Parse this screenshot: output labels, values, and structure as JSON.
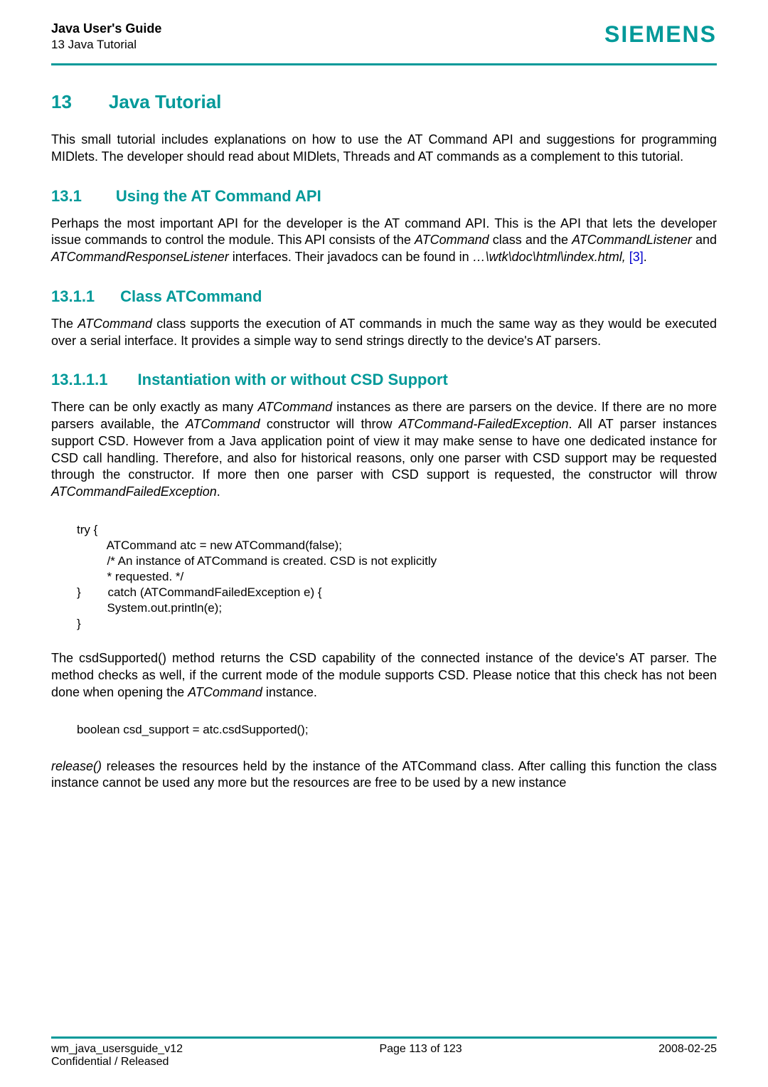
{
  "header": {
    "guide_title": "Java User's Guide",
    "section_ref": "13 Java Tutorial",
    "brand": "SIEMENS"
  },
  "chapter": {
    "num": "13",
    "title": "Java Tutorial",
    "intro": "This small tutorial includes explanations on how to use the AT Command API and suggestions for programming MIDlets. The developer should read about MIDlets, Threads and AT commands as a complement to this tutorial."
  },
  "sec131": {
    "num": "13.1",
    "title": "Using the AT Command API",
    "para_pre": "Perhaps the most important API for the developer is the AT command API. This is the API that lets the developer issue commands to control the module. This API consists of the ",
    "it1": "ATCommand",
    "mid1": " class and the ",
    "it2": "ATCommandListener",
    "mid2": " and ",
    "it3": "ATCommandResponseListener",
    "mid3": " interfaces. Their javadocs can be found in ",
    "it4": "…\\wtk\\doc\\html\\index.html,",
    "link": " [3]",
    "end": "."
  },
  "sec1311": {
    "num": "13.1.1",
    "title": "Class ATCommand",
    "para_pre": "The ",
    "it1": "ATCommand",
    "para_post": " class supports the execution of AT commands in much the same way as they would be executed over a serial interface. It provides a simple way to send strings directly to the device's AT parsers."
  },
  "sec13111": {
    "num": "13.1.1.1",
    "title": "Instantiation with or without CSD Support",
    "para_pre": "There can be only exactly as many ",
    "it1": "ATCommand",
    "mid1": " instances as there are parsers on the device. If there are no more parsers available, the ",
    "it2": "ATCommand",
    "mid2": " constructor will throw ",
    "it3": "ATCommand-FailedException",
    "mid3": ". All AT parser instances support CSD. However from a Java application point of view it may make sense to have one dedicated instance for CSD call handling. Therefore, and also for historical reasons, only one parser with CSD support may be requested through the constructor. If more then one parser with CSD support is requested, the constructor will throw ",
    "it4": "ATCommandFailedException",
    "end": "."
  },
  "code1": "try {\n         ATCommand atc = new ATCommand(false);\n         /* An instance of ATCommand is created. CSD is not explicitly\n         * requested. */\n}        catch (ATCommandFailedException e) {\n         System.out.println(e);\n}",
  "csd_para": {
    "pre": "The csdSupported() method returns the CSD capability of the connected instance of the device's AT parser. The method checks as well, if the current mode of the module supports CSD. Please notice that this check has not been done when opening the ",
    "it": "ATCommand",
    "post": " instance."
  },
  "code2": "boolean csd_support = atc.csdSupported();",
  "release_para": {
    "it": "release()",
    "post": " releases the resources held by the instance of the ATCommand class. After calling this function the class instance cannot be used any more but the resources are free to be used by a new instance"
  },
  "footer": {
    "left1": "wm_java_usersguide_v12",
    "left2": "Confidential / Released",
    "center": "Page 113 of 123",
    "right": "2008-02-25"
  }
}
